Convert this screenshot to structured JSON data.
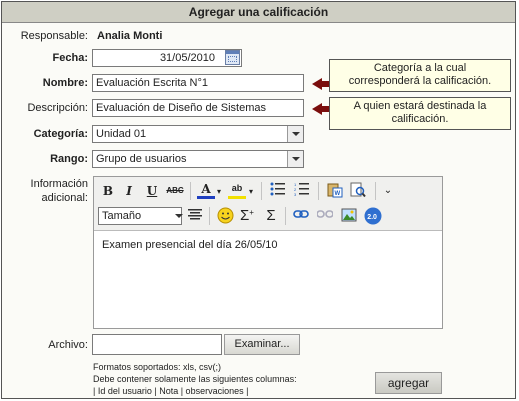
{
  "window": {
    "title": "Agregar una calificación"
  },
  "responsable": {
    "label": "Responsable:",
    "value": "Analia Monti"
  },
  "fecha": {
    "label": "Fecha:",
    "value": "31/05/2010"
  },
  "nombre": {
    "label": "Nombre:",
    "value": "Evaluación Escrita N°1"
  },
  "descripcion": {
    "label": "Descripción:",
    "value": "Evaluación de Diseño de Sistemas"
  },
  "categoria": {
    "label": "Categoría:",
    "value": "Unidad 01"
  },
  "rango": {
    "label": "Rango:",
    "value": "Grupo de usuarios"
  },
  "informacion": {
    "label_line1": "Información",
    "label_line2": "adicional:"
  },
  "callouts": {
    "nombre_line1": "Categoría a la cual",
    "nombre_line2": "corresponderá la calificación.",
    "descripcion_line1": "A quien estará destinada la",
    "descripcion_line2": "calificación."
  },
  "editor": {
    "font_size_select": "Tamaño",
    "content": "Examen presencial del día 26/05/10",
    "icons": [
      "bold-icon",
      "italic-icon",
      "underline-icon",
      "strikethrough-icon",
      "font-color-icon",
      "highlight-icon",
      "bullet-list-icon",
      "numbered-list-icon",
      "paste-word-icon",
      "preview-icon",
      "more-icon",
      "align-icon",
      "smiley-icon",
      "sigma-plus-icon",
      "sigma-icon",
      "link-icon",
      "unlink-icon",
      "image-icon",
      "web2-icon"
    ]
  },
  "archivo": {
    "label": "Archivo:",
    "button": "Examinar..."
  },
  "notes": {
    "line1": "Formatos soportados: xls, csv(;)",
    "line2": "Debe contener solamente las siguientes columnas:",
    "line3": "| Id del usuario | Nota | observaciones |"
  },
  "submit": {
    "label": "agregar"
  },
  "colors": {
    "title_bg": "#cfcfc4",
    "callout_bg": "#ffffe6",
    "arrow": "#7a0d0d",
    "icon_blue": "#1f5fbf"
  }
}
